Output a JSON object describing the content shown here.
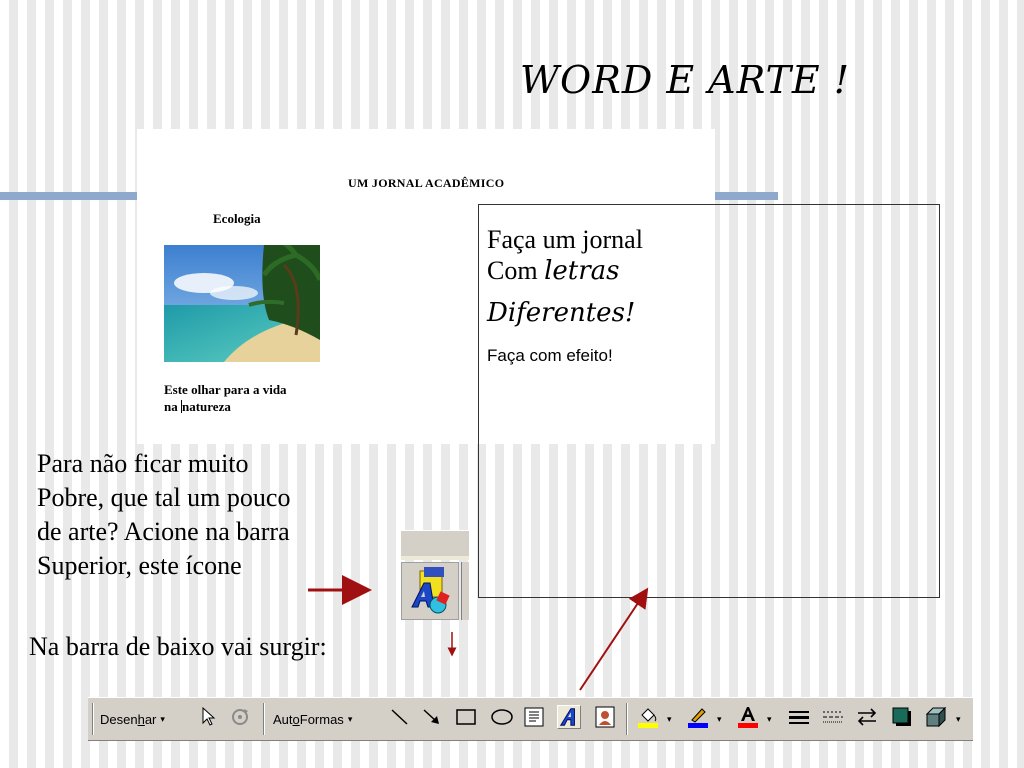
{
  "slide": {
    "title": "WORD E ARTE !"
  },
  "document": {
    "heading": "UM  JORNAL ACADÊMICO",
    "section": "Ecologia",
    "caption_line1": "Este olhar para a vida",
    "caption_line2a": "na ",
    "caption_line2b": "natureza"
  },
  "text_box": {
    "line1": "Faça um jornal",
    "line2_plain": "Com ",
    "line2_fancy": "letras",
    "line3": "Diferentes!",
    "line4": "Faça com efeito!"
  },
  "instructions": {
    "lines": [
      "Para não ficar muito",
      "Pobre, que tal  um pouco",
      "de arte? Acione na barra",
      "Superior, este ícone"
    ],
    "bottom_note": "Na barra de baixo vai surgir:"
  },
  "toolbar": {
    "draw_menu_pre": "Desen",
    "draw_menu_key": "h",
    "draw_menu_post": "ar",
    "autoshapes_pre": "Aut",
    "autoshapes_key": "o",
    "autoshapes_post": "Formas",
    "dropdown_glyph": "▾",
    "icons": [
      "select-objects-icon",
      "free-rotate-icon",
      "line-icon",
      "arrow-icon",
      "rectangle-icon",
      "oval-icon",
      "text-box-icon",
      "wordart-icon",
      "clip-art-icon",
      "fill-color-icon",
      "line-color-icon",
      "font-color-icon",
      "line-style-icon",
      "dash-style-icon",
      "arrow-style-icon",
      "shadow-icon",
      "3d-icon"
    ]
  },
  "colors": {
    "accent_blue": "#8fa9cc",
    "arrow_red": "#a01010",
    "fill_yellow": "#ffff00",
    "line_blue": "#0000ff",
    "font_red": "#ff0000"
  }
}
